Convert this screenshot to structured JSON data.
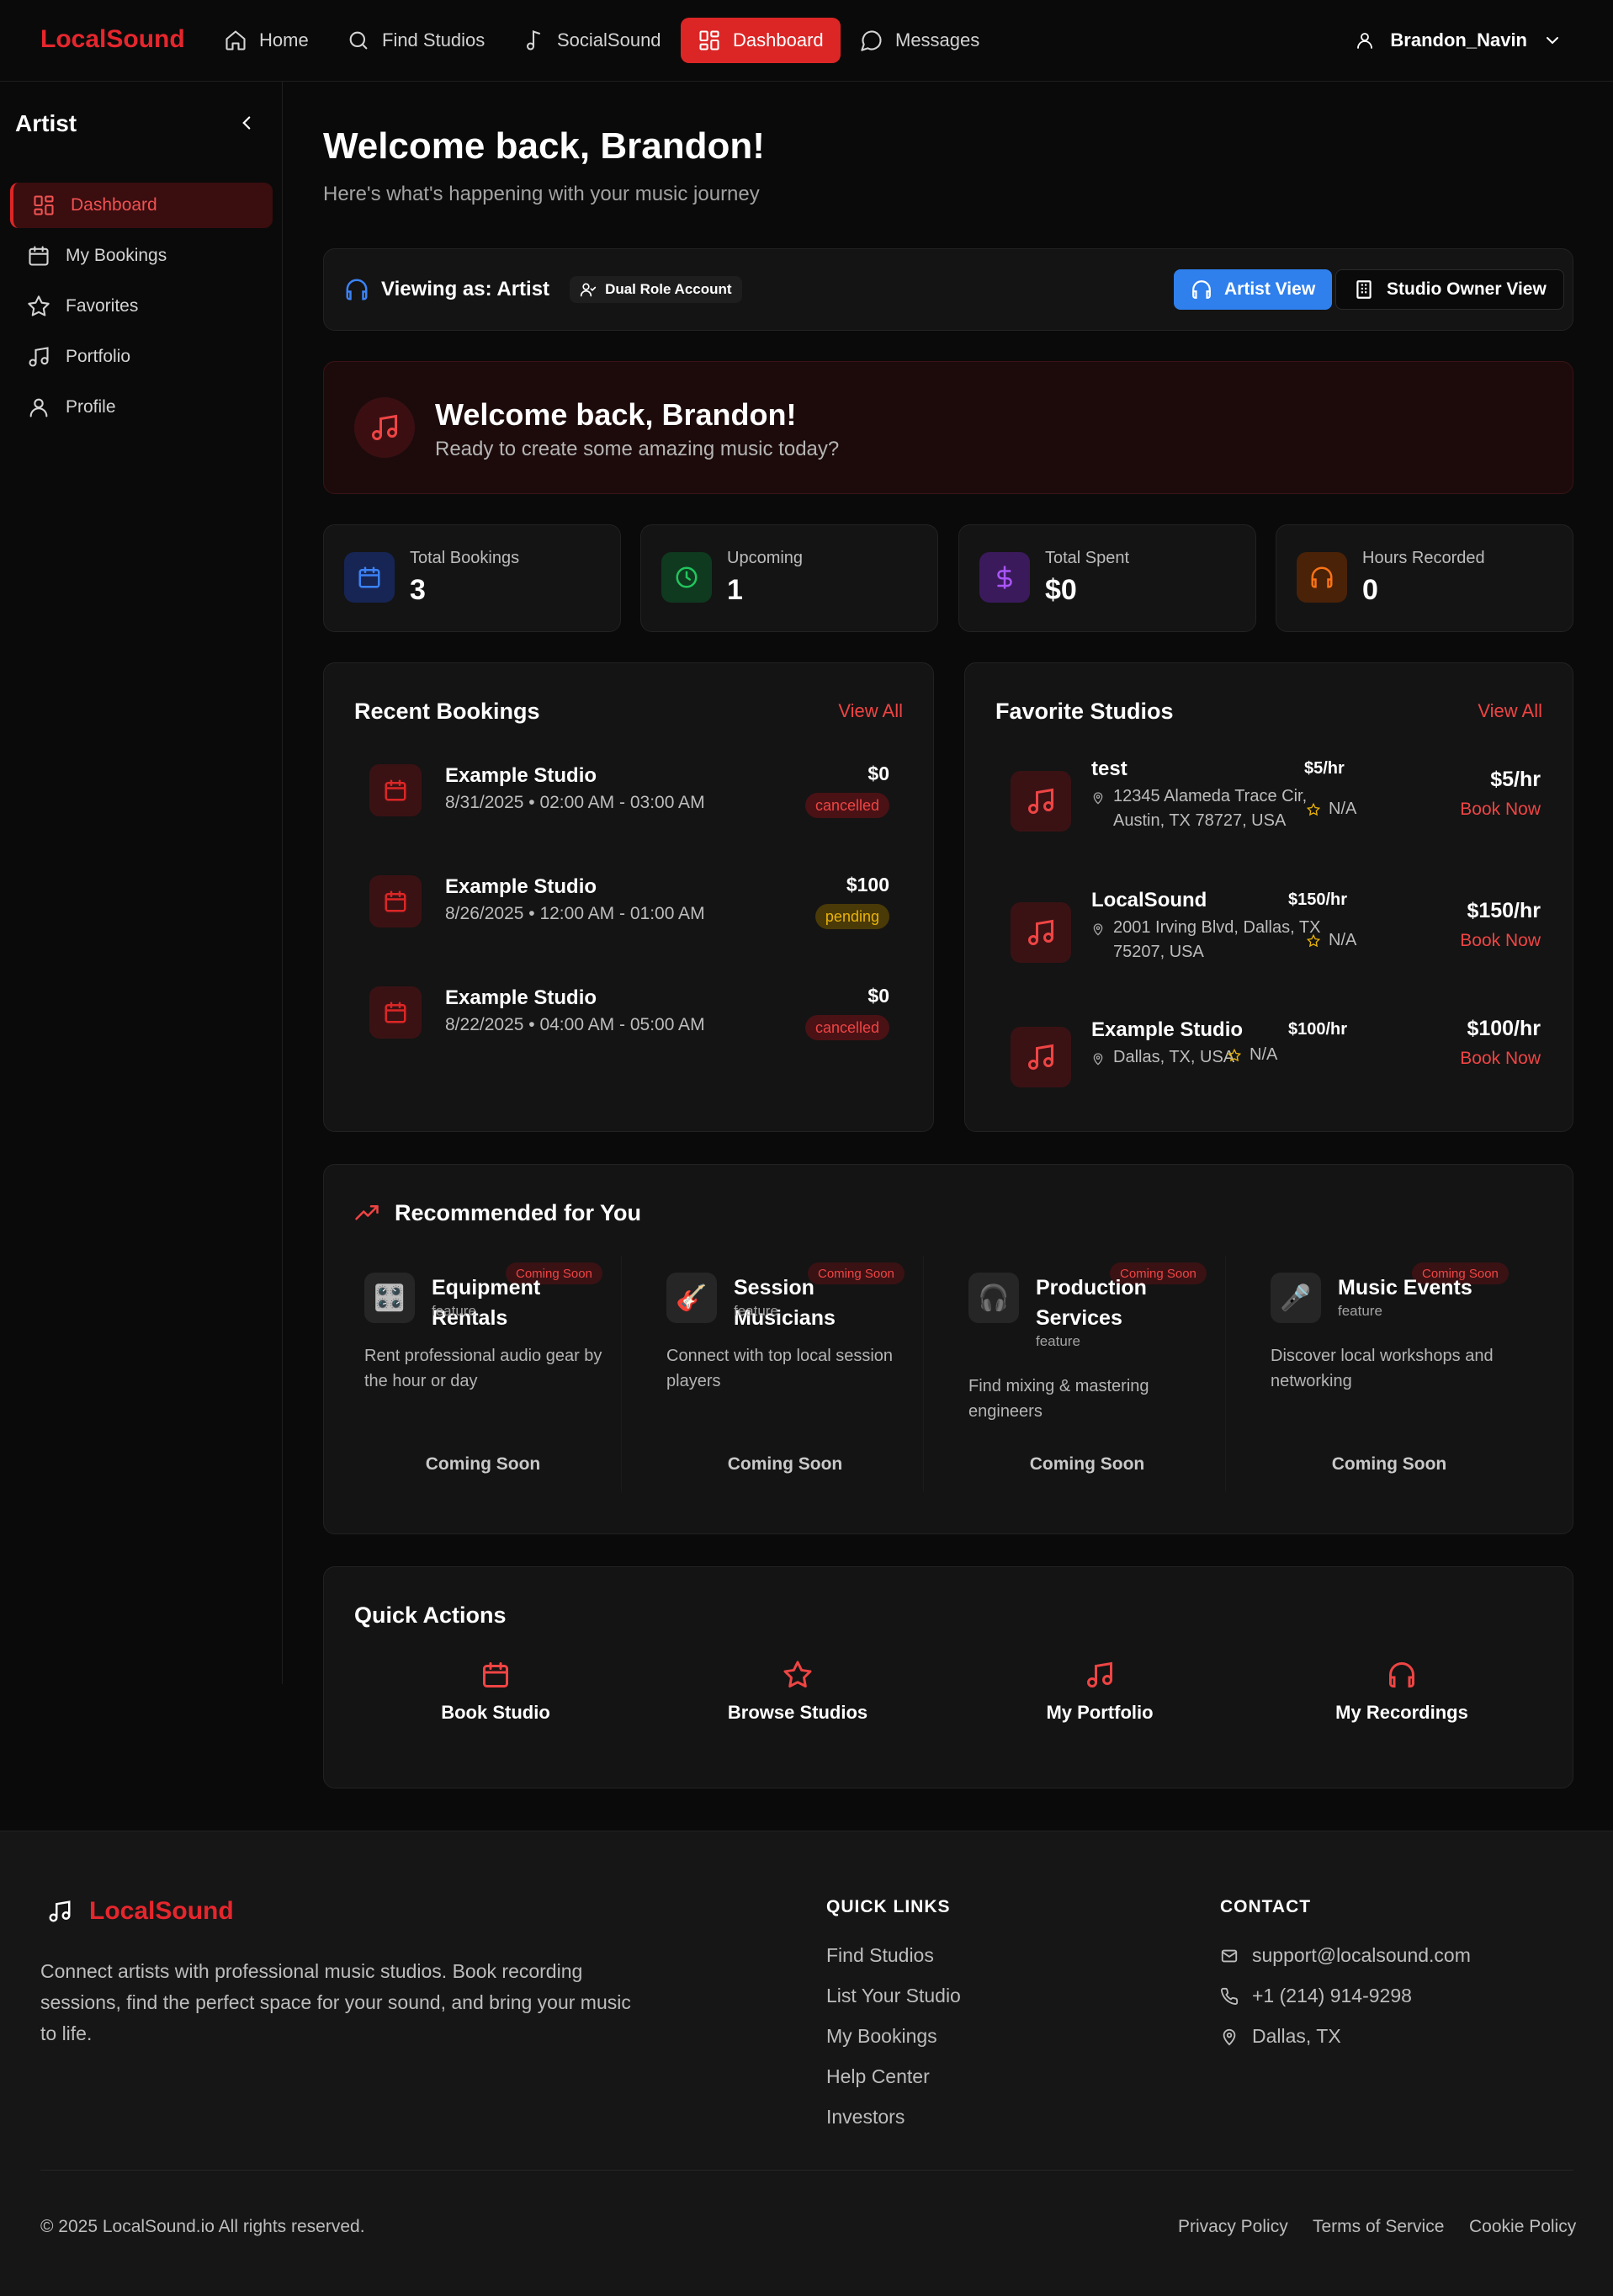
{
  "nav": {
    "brand": "LocalSound",
    "items": [
      {
        "label": "Home",
        "icon": "home-icon"
      },
      {
        "label": "Find Studios",
        "icon": "search-icon"
      },
      {
        "label": "SocialSound",
        "icon": "music-note-icon"
      },
      {
        "label": "Dashboard",
        "icon": "dashboard-icon",
        "active": true
      },
      {
        "label": "Messages",
        "icon": "message-icon"
      }
    ],
    "user": "Brandon_Navin"
  },
  "sidebar": {
    "title": "Artist",
    "items": [
      {
        "label": "Dashboard",
        "active": true
      },
      {
        "label": "My Bookings"
      },
      {
        "label": "Favorites"
      },
      {
        "label": "Portfolio"
      },
      {
        "label": "Profile"
      }
    ]
  },
  "header": {
    "title": "Welcome back, Brandon!",
    "subtitle": "Here's what's happening with your music journey"
  },
  "role": {
    "viewing": "Viewing as: Artist",
    "badge": "Dual Role Account",
    "artist_view": "Artist View",
    "owner_view": "Studio Owner View"
  },
  "welcome": {
    "title": "Welcome back, Brandon!",
    "subtitle": "Ready to create some amazing music today?"
  },
  "stats": [
    {
      "label": "Total Bookings",
      "value": "3",
      "color": "#3b82f6",
      "bg": "#172554"
    },
    {
      "label": "Upcoming",
      "value": "1",
      "color": "#22c55e",
      "bg": "#0f3a1f"
    },
    {
      "label": "Total Spent",
      "value": "$0",
      "color": "#a855f7",
      "bg": "#3b1a5c"
    },
    {
      "label": "Hours Recorded",
      "value": "0",
      "color": "#f97316",
      "bg": "#4a2208"
    }
  ],
  "recent_bookings": {
    "title": "Recent Bookings",
    "view_all": "View All",
    "items": [
      {
        "name": "Example Studio",
        "time": "8/31/2025 • 02:00 AM - 03:00 AM",
        "amount": "$0",
        "status": "cancelled"
      },
      {
        "name": "Example Studio",
        "time": "8/26/2025 • 12:00 AM - 01:00 AM",
        "amount": "$100",
        "status": "pending"
      },
      {
        "name": "Example Studio",
        "time": "8/22/2025 • 04:00 AM - 05:00 AM",
        "amount": "$0",
        "status": "cancelled"
      }
    ]
  },
  "favorite_studios": {
    "title": "Favorite Studios",
    "view_all": "View All",
    "items": [
      {
        "name": "test",
        "address_line1": "12345 Alameda Trace Cir,",
        "address_line2": "Austin, TX 78727, USA",
        "rating": "N/A",
        "price_small": "$5/hr",
        "price": "$5/hr",
        "book": "Book Now"
      },
      {
        "name": "LocalSound",
        "address_line1": "2001 Irving Blvd, Dallas, TX",
        "address_line2": "75207, USA",
        "rating": "N/A",
        "price_small": "$150/hr",
        "price": "$150/hr",
        "book": "Book Now"
      },
      {
        "name": "Example Studio",
        "address_line1": "Dallas, TX, USA",
        "address_line2": "",
        "rating": "N/A",
        "price_small": "$100/hr",
        "price": "$100/hr",
        "book": "Book Now"
      }
    ]
  },
  "recommended": {
    "title": "Recommended for You",
    "items": [
      {
        "name": "Equipment Rentals",
        "tag": "feature",
        "badge": "Coming Soon",
        "desc": "Rent professional audio gear by the hour or day",
        "button": "Coming Soon",
        "icon": "🎛️"
      },
      {
        "name": "Session Musicians",
        "tag": "feature",
        "badge": "Coming Soon",
        "desc": "Connect with top local session players",
        "button": "Coming Soon",
        "icon": "🎸"
      },
      {
        "name": "Production Services",
        "tag": "feature",
        "badge": "Coming Soon",
        "desc": "Find mixing & mastering engineers",
        "button": "Coming Soon",
        "icon": "🎧"
      },
      {
        "name": "Music Events",
        "tag": "feature",
        "badge": "Coming Soon",
        "desc": "Discover local workshops and networking",
        "button": "Coming Soon",
        "icon": "🎤"
      }
    ]
  },
  "quick_actions": {
    "title": "Quick Actions",
    "items": [
      {
        "label": "Book Studio",
        "icon": "calendar-icon"
      },
      {
        "label": "Browse Studios",
        "icon": "star-icon"
      },
      {
        "label": "My Portfolio",
        "icon": "music-note-icon"
      },
      {
        "label": "My Recordings",
        "icon": "headphones-icon"
      }
    ]
  },
  "footer": {
    "brand": "LocalSound",
    "description": "Connect artists with professional music studios. Book recording sessions, find the perfect space for your sound, and bring your music to life.",
    "quick_links_title": "QUICK LINKS",
    "quick_links": [
      "Find Studios",
      "List Your Studio",
      "My Bookings",
      "Help Center",
      "Investors"
    ],
    "contact_title": "CONTACT",
    "email": "support@localsound.com",
    "phone": "+1 (214) 914-9298",
    "location": "Dallas, TX",
    "copyright": "© 2025 LocalSound.io All rights reserved.",
    "legal": [
      "Privacy Policy",
      "Terms of Service",
      "Cookie Policy"
    ]
  },
  "colors": {
    "accent": "#dc2626",
    "blue": "#2f80ed",
    "background": "#0a0a0a",
    "card": "#141414"
  }
}
